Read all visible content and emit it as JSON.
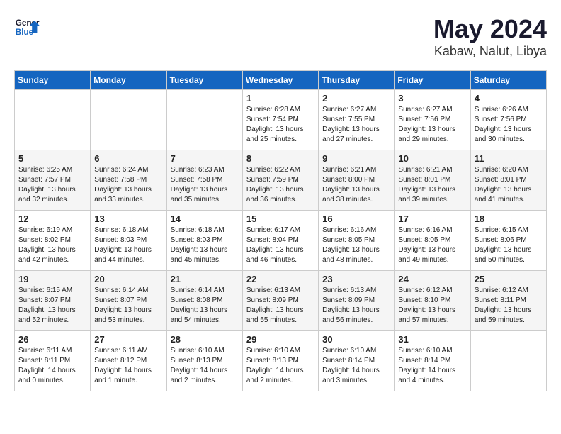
{
  "header": {
    "logo_line1": "General",
    "logo_line2": "Blue",
    "title": "May 2024",
    "subtitle": "Kabaw, Nalut, Libya"
  },
  "weekdays": [
    "Sunday",
    "Monday",
    "Tuesday",
    "Wednesday",
    "Thursday",
    "Friday",
    "Saturday"
  ],
  "weeks": [
    [
      {
        "num": "",
        "sunrise": "",
        "sunset": "",
        "daylight": ""
      },
      {
        "num": "",
        "sunrise": "",
        "sunset": "",
        "daylight": ""
      },
      {
        "num": "",
        "sunrise": "",
        "sunset": "",
        "daylight": ""
      },
      {
        "num": "1",
        "sunrise": "Sunrise: 6:28 AM",
        "sunset": "Sunset: 7:54 PM",
        "daylight": "Daylight: 13 hours and 25 minutes."
      },
      {
        "num": "2",
        "sunrise": "Sunrise: 6:27 AM",
        "sunset": "Sunset: 7:55 PM",
        "daylight": "Daylight: 13 hours and 27 minutes."
      },
      {
        "num": "3",
        "sunrise": "Sunrise: 6:27 AM",
        "sunset": "Sunset: 7:56 PM",
        "daylight": "Daylight: 13 hours and 29 minutes."
      },
      {
        "num": "4",
        "sunrise": "Sunrise: 6:26 AM",
        "sunset": "Sunset: 7:56 PM",
        "daylight": "Daylight: 13 hours and 30 minutes."
      }
    ],
    [
      {
        "num": "5",
        "sunrise": "Sunrise: 6:25 AM",
        "sunset": "Sunset: 7:57 PM",
        "daylight": "Daylight: 13 hours and 32 minutes."
      },
      {
        "num": "6",
        "sunrise": "Sunrise: 6:24 AM",
        "sunset": "Sunset: 7:58 PM",
        "daylight": "Daylight: 13 hours and 33 minutes."
      },
      {
        "num": "7",
        "sunrise": "Sunrise: 6:23 AM",
        "sunset": "Sunset: 7:58 PM",
        "daylight": "Daylight: 13 hours and 35 minutes."
      },
      {
        "num": "8",
        "sunrise": "Sunrise: 6:22 AM",
        "sunset": "Sunset: 7:59 PM",
        "daylight": "Daylight: 13 hours and 36 minutes."
      },
      {
        "num": "9",
        "sunrise": "Sunrise: 6:21 AM",
        "sunset": "Sunset: 8:00 PM",
        "daylight": "Daylight: 13 hours and 38 minutes."
      },
      {
        "num": "10",
        "sunrise": "Sunrise: 6:21 AM",
        "sunset": "Sunset: 8:01 PM",
        "daylight": "Daylight: 13 hours and 39 minutes."
      },
      {
        "num": "11",
        "sunrise": "Sunrise: 6:20 AM",
        "sunset": "Sunset: 8:01 PM",
        "daylight": "Daylight: 13 hours and 41 minutes."
      }
    ],
    [
      {
        "num": "12",
        "sunrise": "Sunrise: 6:19 AM",
        "sunset": "Sunset: 8:02 PM",
        "daylight": "Daylight: 13 hours and 42 minutes."
      },
      {
        "num": "13",
        "sunrise": "Sunrise: 6:18 AM",
        "sunset": "Sunset: 8:03 PM",
        "daylight": "Daylight: 13 hours and 44 minutes."
      },
      {
        "num": "14",
        "sunrise": "Sunrise: 6:18 AM",
        "sunset": "Sunset: 8:03 PM",
        "daylight": "Daylight: 13 hours and 45 minutes."
      },
      {
        "num": "15",
        "sunrise": "Sunrise: 6:17 AM",
        "sunset": "Sunset: 8:04 PM",
        "daylight": "Daylight: 13 hours and 46 minutes."
      },
      {
        "num": "16",
        "sunrise": "Sunrise: 6:16 AM",
        "sunset": "Sunset: 8:05 PM",
        "daylight": "Daylight: 13 hours and 48 minutes."
      },
      {
        "num": "17",
        "sunrise": "Sunrise: 6:16 AM",
        "sunset": "Sunset: 8:05 PM",
        "daylight": "Daylight: 13 hours and 49 minutes."
      },
      {
        "num": "18",
        "sunrise": "Sunrise: 6:15 AM",
        "sunset": "Sunset: 8:06 PM",
        "daylight": "Daylight: 13 hours and 50 minutes."
      }
    ],
    [
      {
        "num": "19",
        "sunrise": "Sunrise: 6:15 AM",
        "sunset": "Sunset: 8:07 PM",
        "daylight": "Daylight: 13 hours and 52 minutes."
      },
      {
        "num": "20",
        "sunrise": "Sunrise: 6:14 AM",
        "sunset": "Sunset: 8:07 PM",
        "daylight": "Daylight: 13 hours and 53 minutes."
      },
      {
        "num": "21",
        "sunrise": "Sunrise: 6:14 AM",
        "sunset": "Sunset: 8:08 PM",
        "daylight": "Daylight: 13 hours and 54 minutes."
      },
      {
        "num": "22",
        "sunrise": "Sunrise: 6:13 AM",
        "sunset": "Sunset: 8:09 PM",
        "daylight": "Daylight: 13 hours and 55 minutes."
      },
      {
        "num": "23",
        "sunrise": "Sunrise: 6:13 AM",
        "sunset": "Sunset: 8:09 PM",
        "daylight": "Daylight: 13 hours and 56 minutes."
      },
      {
        "num": "24",
        "sunrise": "Sunrise: 6:12 AM",
        "sunset": "Sunset: 8:10 PM",
        "daylight": "Daylight: 13 hours and 57 minutes."
      },
      {
        "num": "25",
        "sunrise": "Sunrise: 6:12 AM",
        "sunset": "Sunset: 8:11 PM",
        "daylight": "Daylight: 13 hours and 59 minutes."
      }
    ],
    [
      {
        "num": "26",
        "sunrise": "Sunrise: 6:11 AM",
        "sunset": "Sunset: 8:11 PM",
        "daylight": "Daylight: 14 hours and 0 minutes."
      },
      {
        "num": "27",
        "sunrise": "Sunrise: 6:11 AM",
        "sunset": "Sunset: 8:12 PM",
        "daylight": "Daylight: 14 hours and 1 minute."
      },
      {
        "num": "28",
        "sunrise": "Sunrise: 6:10 AM",
        "sunset": "Sunset: 8:13 PM",
        "daylight": "Daylight: 14 hours and 2 minutes."
      },
      {
        "num": "29",
        "sunrise": "Sunrise: 6:10 AM",
        "sunset": "Sunset: 8:13 PM",
        "daylight": "Daylight: 14 hours and 2 minutes."
      },
      {
        "num": "30",
        "sunrise": "Sunrise: 6:10 AM",
        "sunset": "Sunset: 8:14 PM",
        "daylight": "Daylight: 14 hours and 3 minutes."
      },
      {
        "num": "31",
        "sunrise": "Sunrise: 6:10 AM",
        "sunset": "Sunset: 8:14 PM",
        "daylight": "Daylight: 14 hours and 4 minutes."
      },
      {
        "num": "",
        "sunrise": "",
        "sunset": "",
        "daylight": ""
      }
    ]
  ]
}
